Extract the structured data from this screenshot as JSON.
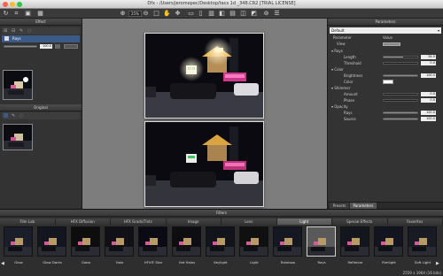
{
  "window": {
    "title": "Dfx - /Users/jeromepec/Desktop/tacs 1d _348.CR2 [TRIAL LICENSE]"
  },
  "toolbar": {
    "zoom_value": "25%"
  },
  "left_panel": {
    "effect_header": "Effect",
    "layer_name": "Rays",
    "opacity_value": "100.0",
    "original_header": "Original"
  },
  "right_panel": {
    "header": "Parameters",
    "preset_value": "Default",
    "col_parameter": "Parameter",
    "col_value": "Value",
    "view_label": "View",
    "groups": [
      {
        "name": "Rays",
        "params": [
          {
            "label": "Length",
            "value": "56.9",
            "fill": 0.57
          },
          {
            "label": "Threshold",
            "value": "0.0",
            "fill": 0.0
          }
        ]
      },
      {
        "name": "Color",
        "params": [
          {
            "label": "Brightness",
            "value": "100.0",
            "fill": 1.0
          },
          {
            "label": "Color",
            "value": "",
            "fill": 0
          }
        ]
      },
      {
        "name": "Shimmer",
        "params": [
          {
            "label": "Amount",
            "value": "0.0",
            "fill": 0.0
          },
          {
            "label": "Phase",
            "value": "0.0",
            "fill": 0.0
          }
        ]
      },
      {
        "name": "Opacity",
        "params": [
          {
            "label": "Rays",
            "value": "100.0",
            "fill": 1.0
          },
          {
            "label": "Source",
            "value": "100.0",
            "fill": 1.0
          }
        ]
      }
    ],
    "tabs": [
      "Presets",
      "Parameters"
    ]
  },
  "filters": {
    "header": "Filters",
    "categories": [
      "Film Lab",
      "HFX Diffusion",
      "HFX Grads/Tints",
      "Image",
      "Lens",
      "Light",
      "Special Effects",
      "Favorites"
    ],
    "active_category": "Light",
    "thumbnails": [
      "Glow",
      "Glow Darks",
      "Gobo",
      "Halo",
      "HFX® Star",
      "Hot Halos",
      "Keylight",
      "Light",
      "Rainbow",
      "Rays",
      "Reflector",
      "Rimlight",
      "Soft Light"
    ],
    "selected_thumbnail": "Rays"
  },
  "status": {
    "dimensions": "2559 x 1964 (16 bits)"
  }
}
